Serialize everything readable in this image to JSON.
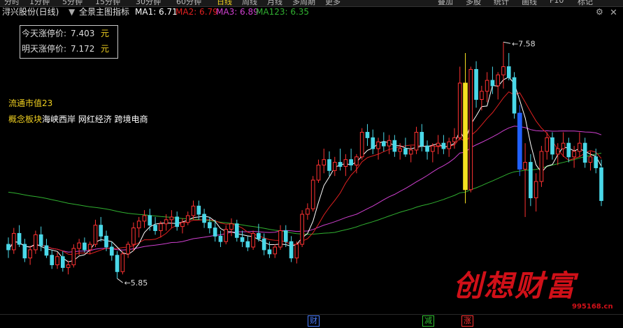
{
  "topbar": {
    "periods": [
      "分时",
      "1分钟",
      "5分钟",
      "15分钟",
      "30分钟",
      "60分钟",
      "日线",
      "周线",
      "月线",
      "多周期",
      "更多"
    ],
    "active_period": "日线",
    "right_buttons": [
      "叠加",
      "多股",
      "统计",
      "画线",
      "F10",
      "标记"
    ]
  },
  "header": {
    "stock": "浔兴股份(日线)",
    "indicator": "全景主图指标",
    "ma1": "MA1: 6.71",
    "ma2": "MA2: 6.79",
    "ma3": "MA3: 6.89",
    "ma123": "MA123: 6.35"
  },
  "colors": {
    "up": "#ff3232",
    "down": "#4ad8e8",
    "ma1": "#ffffff",
    "ma2": "#e02020",
    "ma3": "#d040d0",
    "ma123": "#30b030",
    "yellow": "#f5e020",
    "blue": "#2060ff"
  },
  "infobox": {
    "today_label": "今天涨停价:",
    "today_value": "7.403",
    "tomorrow_label": "明天涨停价:",
    "tomorrow_value": "7.172",
    "unit": "元"
  },
  "market_cap": {
    "label": "流通市值",
    "value": "23"
  },
  "concept": {
    "label": "概念板块",
    "value": "海峡西岸 网红经济 跨境电商"
  },
  "annotations": {
    "high": "7.58",
    "low": "5.85"
  },
  "bottom_marks": [
    {
      "text": "财",
      "color": "#4a7dff"
    },
    {
      "text": "减",
      "color": "#30c030"
    },
    {
      "text": "涨",
      "color": "#ff3232"
    }
  ],
  "watermark": {
    "text": "创想财富",
    "url": "995168.cn"
  },
  "chart_data": {
    "type": "candlestick",
    "ylim": [
      5.6,
      7.75
    ],
    "candles": [
      [
        6.1,
        6.15,
        6.0,
        6.06
      ],
      [
        6.06,
        6.22,
        6.03,
        6.18
      ],
      [
        6.18,
        6.24,
        6.08,
        6.1
      ],
      [
        6.1,
        6.14,
        5.97,
        6.0
      ],
      [
        6.0,
        6.09,
        5.95,
        6.06
      ],
      [
        6.06,
        6.2,
        6.03,
        6.17
      ],
      [
        6.17,
        6.23,
        6.05,
        6.09
      ],
      [
        6.09,
        6.14,
        6.0,
        6.02
      ],
      [
        6.02,
        6.06,
        5.92,
        5.95
      ],
      [
        5.95,
        6.04,
        5.92,
        6.01
      ],
      [
        6.01,
        6.05,
        5.9,
        5.93
      ],
      [
        5.93,
        5.98,
        5.88,
        5.95
      ],
      [
        5.95,
        6.1,
        5.93,
        6.07
      ],
      [
        6.07,
        6.14,
        6.02,
        6.11
      ],
      [
        6.11,
        6.15,
        6.04,
        6.06
      ],
      [
        6.06,
        6.12,
        6.03,
        6.1
      ],
      [
        6.1,
        6.28,
        6.08,
        6.24
      ],
      [
        6.24,
        6.3,
        6.12,
        6.16
      ],
      [
        6.16,
        6.2,
        6.05,
        6.08
      ],
      [
        6.08,
        6.12,
        5.98,
        6.02
      ],
      [
        6.02,
        6.05,
        5.85,
        5.9
      ],
      [
        5.9,
        6.05,
        5.88,
        6.03
      ],
      [
        6.03,
        6.12,
        6.0,
        6.1
      ],
      [
        6.1,
        6.26,
        6.05,
        6.22
      ],
      [
        6.22,
        6.3,
        6.15,
        6.27
      ],
      [
        6.27,
        6.35,
        6.22,
        6.31
      ],
      [
        6.31,
        6.36,
        6.2,
        6.24
      ],
      [
        6.24,
        6.3,
        6.17,
        6.2
      ],
      [
        6.2,
        6.27,
        6.15,
        6.25
      ],
      [
        6.25,
        6.32,
        6.2,
        6.28
      ],
      [
        6.28,
        6.35,
        6.22,
        6.3
      ],
      [
        6.3,
        6.34,
        6.2,
        6.23
      ],
      [
        6.23,
        6.29,
        6.18,
        6.26
      ],
      [
        6.26,
        6.34,
        6.24,
        6.31
      ],
      [
        6.31,
        6.42,
        6.28,
        6.38
      ],
      [
        6.38,
        6.42,
        6.28,
        6.32
      ],
      [
        6.32,
        6.36,
        6.22,
        6.26
      ],
      [
        6.26,
        6.3,
        6.18,
        6.22
      ],
      [
        6.22,
        6.28,
        6.12,
        6.16
      ],
      [
        6.16,
        6.2,
        6.08,
        6.12
      ],
      [
        6.12,
        6.24,
        6.1,
        6.21
      ],
      [
        6.21,
        6.29,
        6.16,
        6.25
      ],
      [
        6.25,
        6.28,
        6.12,
        6.15
      ],
      [
        6.15,
        6.2,
        6.08,
        6.12
      ],
      [
        6.12,
        6.16,
        6.05,
        6.08
      ],
      [
        6.08,
        6.2,
        6.06,
        6.18
      ],
      [
        6.18,
        6.25,
        6.12,
        6.14
      ],
      [
        6.14,
        6.18,
        6.02,
        6.06
      ],
      [
        6.06,
        6.12,
        6.0,
        6.03
      ],
      [
        6.03,
        6.1,
        6.0,
        6.08
      ],
      [
        6.08,
        6.24,
        6.06,
        6.2
      ],
      [
        6.2,
        6.24,
        6.08,
        6.12
      ],
      [
        6.12,
        6.16,
        5.97,
        6.0
      ],
      [
        6.0,
        6.12,
        5.96,
        6.1
      ],
      [
        6.1,
        6.35,
        6.08,
        6.32
      ],
      [
        6.32,
        6.4,
        6.28,
        6.36
      ],
      [
        6.36,
        6.6,
        6.34,
        6.57
      ],
      [
        6.57,
        6.72,
        6.55,
        6.68
      ],
      [
        6.68,
        6.8,
        6.62,
        6.72
      ],
      [
        6.72,
        6.78,
        6.6,
        6.64
      ],
      [
        6.64,
        6.74,
        6.6,
        6.7
      ],
      [
        6.7,
        6.8,
        6.64,
        6.67
      ],
      [
        6.67,
        6.76,
        6.6,
        6.72
      ],
      [
        6.72,
        6.8,
        6.64,
        6.68
      ],
      [
        6.68,
        6.76,
        6.62,
        6.74
      ],
      [
        6.74,
        6.95,
        6.72,
        6.92
      ],
      [
        6.92,
        6.98,
        6.82,
        6.88
      ],
      [
        6.88,
        6.94,
        6.76,
        6.8
      ],
      [
        6.8,
        6.88,
        6.72,
        6.85
      ],
      [
        6.85,
        6.92,
        6.78,
        6.82
      ],
      [
        6.82,
        6.9,
        6.76,
        6.86
      ],
      [
        6.86,
        6.9,
        6.74,
        6.78
      ],
      [
        6.78,
        6.84,
        6.72,
        6.8
      ],
      [
        6.8,
        6.88,
        6.74,
        6.76
      ],
      [
        6.76,
        6.82,
        6.7,
        6.79
      ],
      [
        6.79,
        6.96,
        6.76,
        6.92
      ],
      [
        6.92,
        6.98,
        6.78,
        6.82
      ],
      [
        6.82,
        6.86,
        6.72,
        6.78
      ],
      [
        6.78,
        6.84,
        6.7,
        6.82
      ],
      [
        6.82,
        6.9,
        6.76,
        6.84
      ],
      [
        6.84,
        6.9,
        6.76,
        6.8
      ],
      [
        6.8,
        6.88,
        6.74,
        6.85
      ],
      [
        6.85,
        6.95,
        6.8,
        6.88
      ],
      [
        6.88,
        7.4,
        6.86,
        7.28
      ],
      [
        7.28,
        7.5,
        6.4,
        6.5
      ],
      [
        6.5,
        7.4,
        6.48,
        7.38
      ],
      [
        7.38,
        7.44,
        7.1,
        7.16
      ],
      [
        7.16,
        7.26,
        7.08,
        7.22
      ],
      [
        7.22,
        7.36,
        7.14,
        7.3
      ],
      [
        7.3,
        7.4,
        7.2,
        7.26
      ],
      [
        7.26,
        7.36,
        7.16,
        7.34
      ],
      [
        7.34,
        7.58,
        7.24,
        7.4
      ],
      [
        7.4,
        7.5,
        7.3,
        7.32
      ],
      [
        7.32,
        7.36,
        7.02,
        7.06
      ],
      [
        7.06,
        7.12,
        6.6,
        6.65
      ],
      [
        6.65,
        6.84,
        6.3,
        6.7
      ],
      [
        6.7,
        6.76,
        6.38,
        6.44
      ],
      [
        6.44,
        6.62,
        6.34,
        6.56
      ],
      [
        6.56,
        6.82,
        6.52,
        6.78
      ],
      [
        6.78,
        6.92,
        6.72,
        6.88
      ],
      [
        6.88,
        6.92,
        6.72,
        6.76
      ],
      [
        6.76,
        6.84,
        6.68,
        6.8
      ],
      [
        6.8,
        6.92,
        6.74,
        6.84
      ],
      [
        6.84,
        6.88,
        6.7,
        6.74
      ],
      [
        6.74,
        6.82,
        6.66,
        6.78
      ],
      [
        6.78,
        6.92,
        6.74,
        6.84
      ],
      [
        6.84,
        6.88,
        6.66,
        6.7
      ],
      [
        6.7,
        6.78,
        6.64,
        6.74
      ],
      [
        6.74,
        6.8,
        6.62,
        6.66
      ],
      [
        6.66,
        6.72,
        6.38,
        6.42
      ]
    ],
    "highlight": {
      "yellow_index": 84,
      "blue_index": 94
    }
  }
}
